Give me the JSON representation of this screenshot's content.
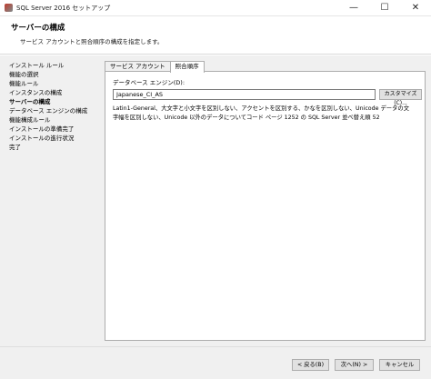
{
  "window": {
    "title": "SQL Server 2016 セットアップ",
    "minimize_glyph": "—",
    "maximize_glyph": "☐",
    "close_glyph": "✕"
  },
  "header": {
    "title": "サーバーの構成",
    "description": "サービス アカウントと照合順序の構成を指定します。"
  },
  "sidebar": {
    "items": [
      {
        "label": "インストール ルール",
        "active": false
      },
      {
        "label": "機能の選択",
        "active": false
      },
      {
        "label": "機能ルール",
        "active": false
      },
      {
        "label": "インスタンスの構成",
        "active": false
      },
      {
        "label": "サーバーの構成",
        "active": true
      },
      {
        "label": "データベース エンジンの構成",
        "active": false
      },
      {
        "label": "機能構成ルール",
        "active": false
      },
      {
        "label": "インストールの準備完了",
        "active": false
      },
      {
        "label": "インストールの進行状況",
        "active": false
      },
      {
        "label": "完了",
        "active": false
      }
    ]
  },
  "tabs": [
    {
      "label": "サービス アカウント",
      "selected": false
    },
    {
      "label": "照合順序",
      "selected": true
    }
  ],
  "collation": {
    "engine_label": "データベース エンジン(D):",
    "value": "Japanese_CI_AS",
    "customize_label": "カスタマイズ(C)...",
    "description_lines": [
      "Latin1-General、大文字と小文字を区別しない、アクセントを区別する、かなを区別しない、Unicode データの文",
      "字幅を区別しない、Unicode 以外のデータについてコード ページ 1252 の SQL Server 並べ替え順 52"
    ]
  },
  "footer": {
    "back_label": "< 戻る(B)",
    "next_label": "次へ(N) >",
    "cancel_label": "キャンセル"
  }
}
